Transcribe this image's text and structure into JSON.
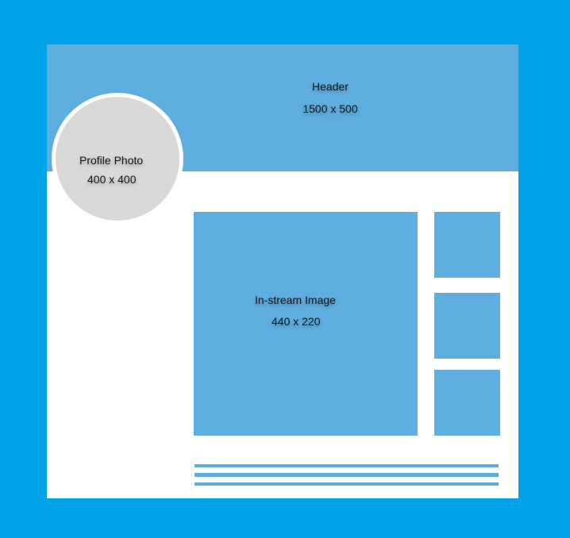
{
  "header": {
    "title": "Header",
    "size": "1500 x 500"
  },
  "profile_photo": {
    "title": "Profile Photo",
    "size": "400 x 400"
  },
  "instream_image": {
    "title": "In-stream Image",
    "size": "440 x 220"
  },
  "colors": {
    "background": "#00a2e8",
    "placeholder_blue": "#5faee0",
    "profile_gray": "#d9d9d9",
    "card": "#ffffff"
  }
}
